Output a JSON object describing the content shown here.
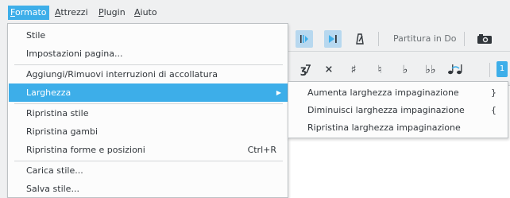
{
  "menubar": {
    "items": [
      {
        "label": "Formato",
        "accel": "F",
        "rest": "ormato"
      },
      {
        "label": "Attrezzi",
        "accel": "A",
        "rest": "ttrezzi"
      },
      {
        "label": "Plugin",
        "accel": "P",
        "rest": "lugin"
      },
      {
        "label": "Aiuto",
        "accel": "A",
        "rest": "iuto"
      }
    ]
  },
  "toolbar": {
    "score_label": "Partitura in Do",
    "voice_number": "1",
    "accidentals": [
      {
        "name": "flip",
        "glyph": "↗"
      },
      {
        "name": "double-sharp",
        "glyph": "×"
      },
      {
        "name": "sharp",
        "glyph": "♯"
      },
      {
        "name": "natural",
        "glyph": "♮"
      },
      {
        "name": "flat",
        "glyph": "♭"
      },
      {
        "name": "double-flat",
        "glyph": "♭♭"
      },
      {
        "name": "tie",
        "glyph": "♪"
      }
    ]
  },
  "format_menu": {
    "items": [
      {
        "label": "Stile"
      },
      {
        "label": "Impostazioni pagina..."
      },
      {
        "label": "Aggiungi/Rimuovi interruzioni di accollatura"
      },
      {
        "label": "Larghezza",
        "has_submenu": true
      },
      {
        "label": "Ripristina stile"
      },
      {
        "label": "Ripristina gambi"
      },
      {
        "label": "Ripristina forme e posizioni",
        "shortcut": "Ctrl+R"
      },
      {
        "label": "Carica stile..."
      },
      {
        "label": "Salva stile..."
      }
    ]
  },
  "width_submenu": {
    "items": [
      {
        "label": "Aumenta larghezza impaginazione",
        "shortcut": "}"
      },
      {
        "label": "Diminuisci larghezza impaginazione",
        "shortcut": "{"
      },
      {
        "label": "Ripristina larghezza impaginazione"
      }
    ]
  },
  "colors": {
    "highlight": "#3daee9",
    "menu_bg": "#fcfcfc",
    "window_bg": "#eff0f1"
  }
}
